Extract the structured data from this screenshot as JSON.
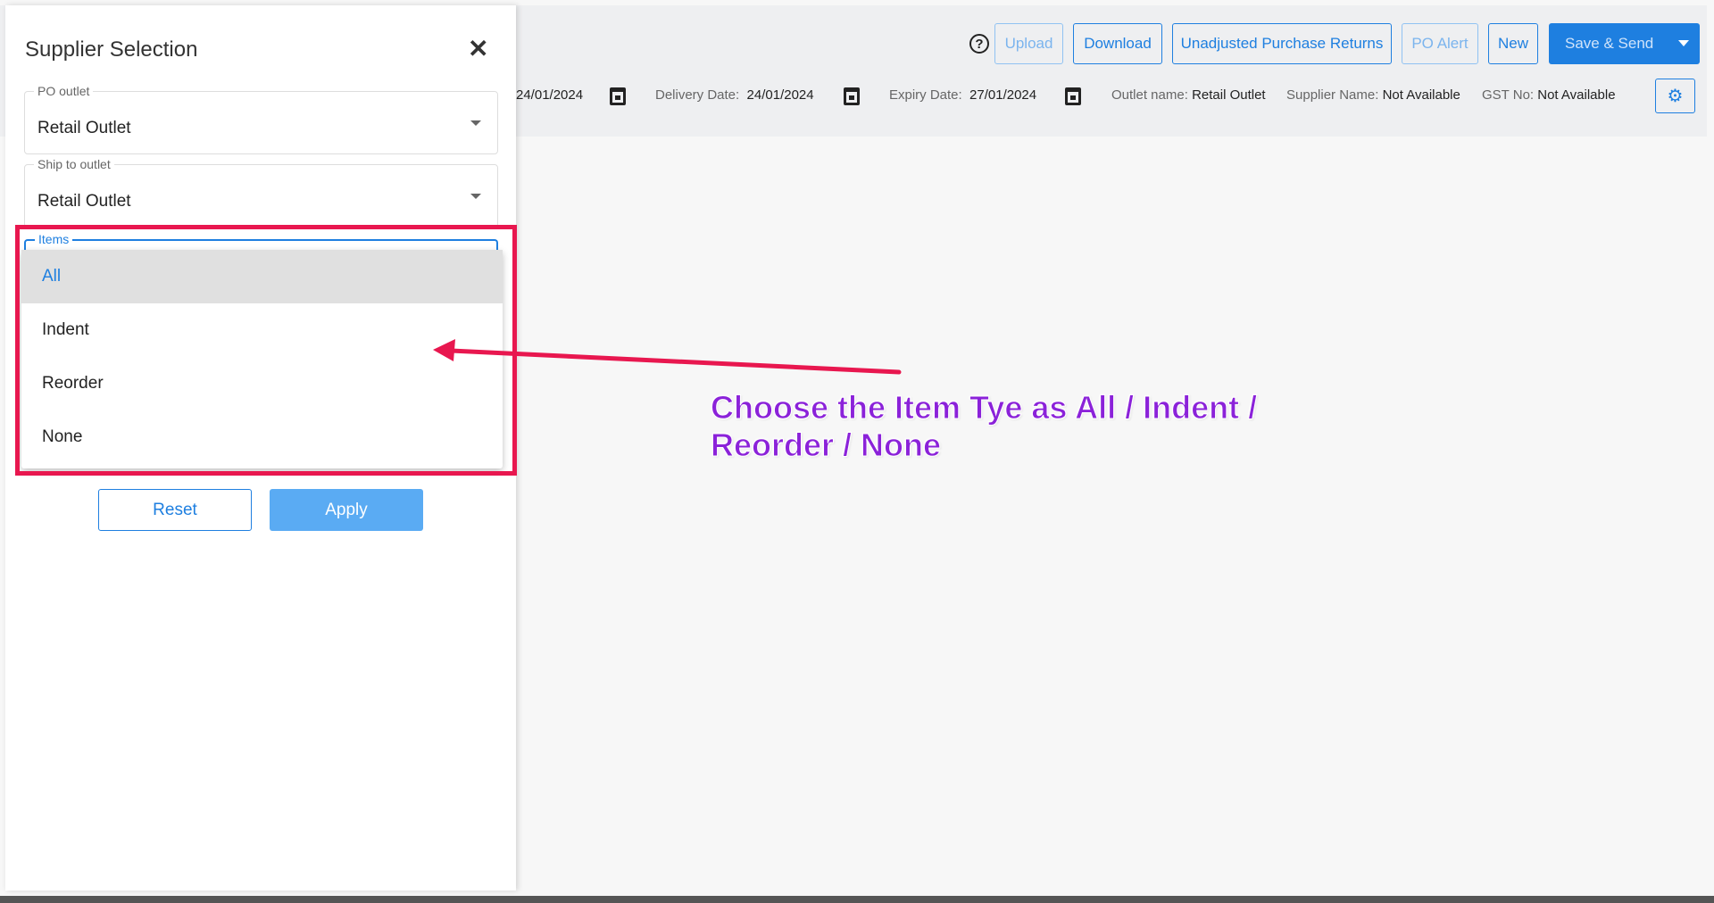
{
  "toolbar": {
    "upload": "Upload",
    "download": "Download",
    "unadjusted": "Unadjusted Purchase Returns",
    "po_alert": "PO Alert",
    "new": "New",
    "save_send": "Save & Send"
  },
  "info": {
    "po_date": "24/01/2024",
    "delivery_label": "Delivery Date:",
    "delivery_value": "24/01/2024",
    "expiry_label": "Expiry Date:",
    "expiry_value": "27/01/2024",
    "outlet_label": "Outlet name:",
    "outlet_value": "Retail Outlet",
    "supplier_label": "Supplier Name:",
    "supplier_value": "Not Available",
    "gst_label": "GST No:",
    "gst_value": "Not Available"
  },
  "panel": {
    "title": "Supplier Selection",
    "po_outlet_label": "PO outlet",
    "po_outlet_value": "Retail Outlet",
    "ship_label": "Ship to outlet",
    "ship_value": "Retail Outlet",
    "items_label": "Items",
    "options": [
      "All",
      "Indent",
      "Reorder",
      "None"
    ],
    "reset": "Reset",
    "apply": "Apply"
  },
  "annotation": {
    "line1": "Choose the Item Tye as All / Indent /",
    "line2": "Reorder / None"
  },
  "colors": {
    "accent": "#1e7fe0",
    "highlight": "#e8174f",
    "annotation": "#8b22d9"
  }
}
